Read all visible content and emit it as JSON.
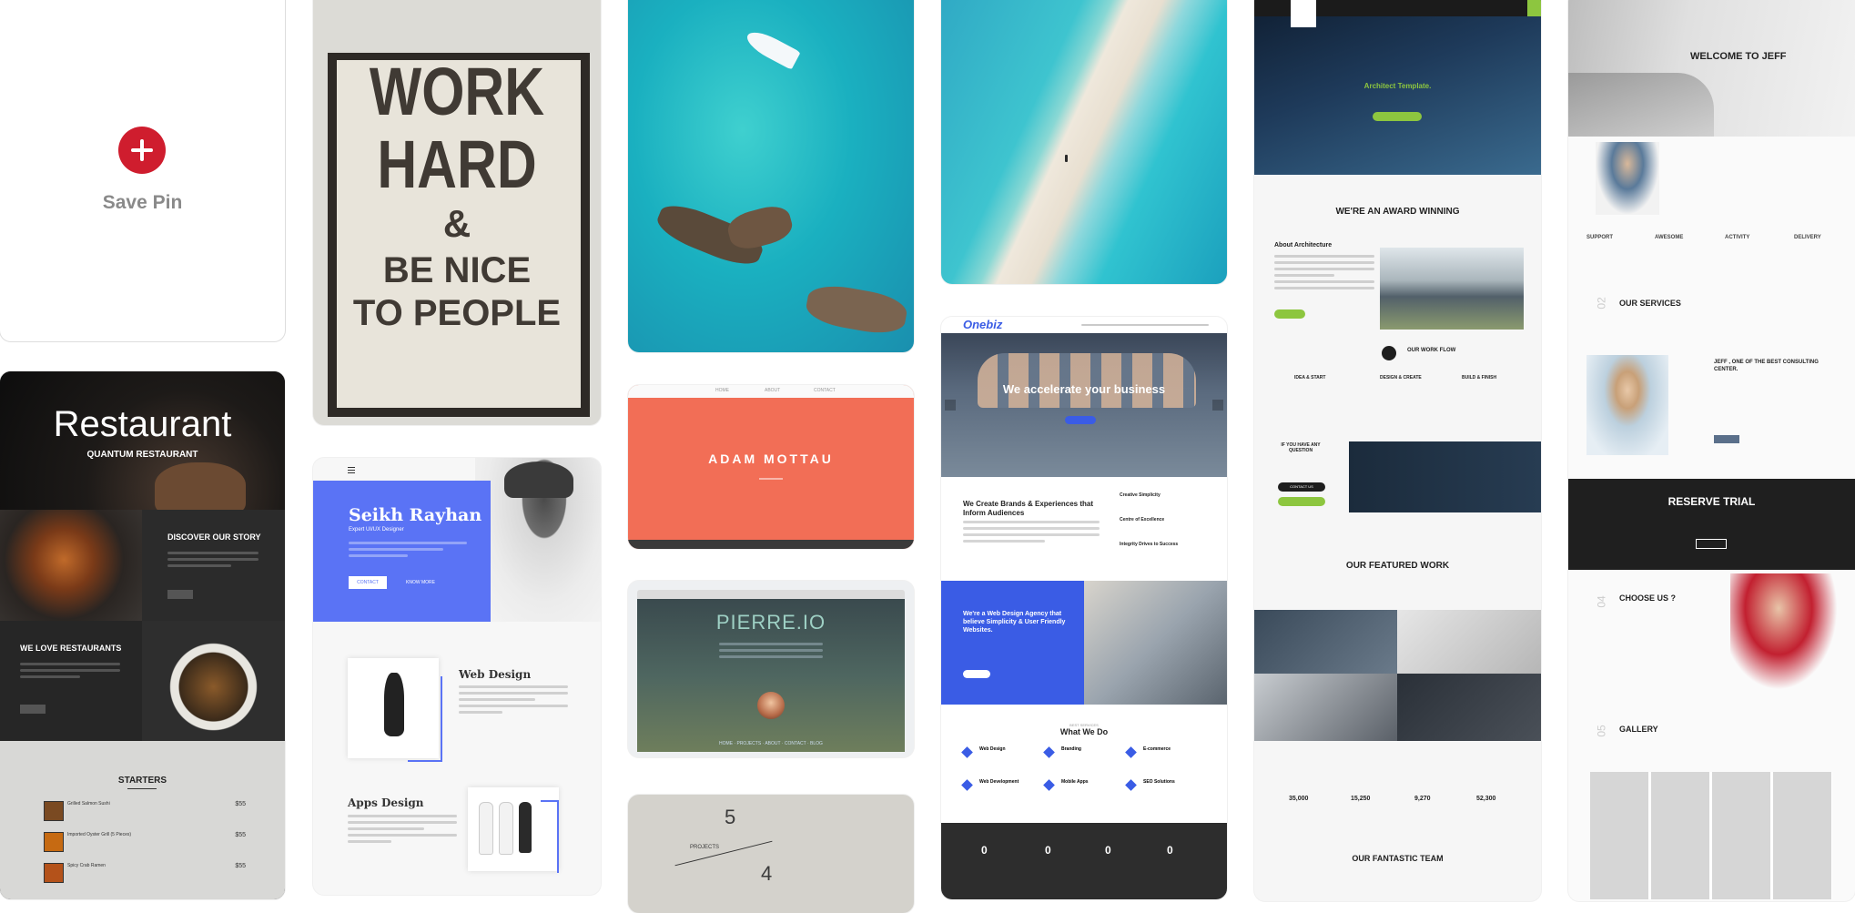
{
  "save_pin": {
    "label": "Save Pin"
  },
  "restaurant": {
    "title": "Restaurant",
    "subtitle": "QUANTUM RESTAURANT",
    "story_heading": "DISCOVER OUR STORY",
    "love_heading": "WE LOVE RESTAURANTS",
    "menu_heading": "STARTERS",
    "menu_items": [
      {
        "name": "Grilled Salmon Sushi",
        "price": "$55"
      },
      {
        "name": "Imported Oyster Grill (5 Pieces)",
        "price": "$55"
      },
      {
        "name": "Spicy Crab Ramen",
        "price": "$55"
      }
    ]
  },
  "poster": {
    "lines": [
      "WORK",
      "HARD",
      "&",
      "BE NICE",
      "TO PEOPLE"
    ]
  },
  "portfolio": {
    "name": "Seikh Rayhan",
    "role": "Expert UI/UX Designer",
    "contact_button": "CONTACT",
    "more_button": "KNOW MORE",
    "section1": "Web Design",
    "section2": "Apps Design"
  },
  "adam": {
    "name": "ADAM MOTTAU",
    "nav": [
      "HOME",
      "ABOUT",
      "CONTACT"
    ]
  },
  "pierre": {
    "title": "PIERRE.IO"
  },
  "projects": {
    "number1": "5",
    "number2": "4",
    "label": "PROJECTS"
  },
  "onebiz": {
    "logo": "Onebiz",
    "hero": "We accelerate your business",
    "brands_heading": "We Create Brands & Experiences that Inform Audiences",
    "features": [
      "Creative Simplicity",
      "Centre of Excellence",
      "Integrity Drives to Success"
    ],
    "agency_heading": "We're a Web Design Agency that believe Simplicity & User Friendly Websites.",
    "what_sub": "BEST SERVICES",
    "what_heading": "What We Do",
    "services": [
      "Web Design",
      "Branding",
      "E-commerce",
      "Web Development",
      "Mobile Apps",
      "SEO Solutions"
    ],
    "stats": [
      "0",
      "0",
      "0",
      "0"
    ]
  },
  "architect": {
    "hero_title": "Architect Template.",
    "award": "WE'RE AN AWARD WINNING",
    "about": "About Architecture",
    "workflow": "OUR WORK FLOW",
    "steps": [
      "IDEA & START",
      "DESIGN & CREATE",
      "BUILD & FINISH"
    ],
    "question": "IF YOU HAVE ANY QUESTION",
    "contact": "CONTACT US",
    "featured": "OUR FEATURED WORK",
    "stats": [
      "35,000",
      "15,250",
      "9,270",
      "52,300"
    ],
    "team": "OUR FANTASTIC TEAM"
  },
  "jeff": {
    "welcome": "WELCOME TO JEFF",
    "features": [
      "SUPPORT",
      "AWESOME",
      "ACTIVITY",
      "DELIVERY"
    ],
    "services_num": "02",
    "services": "OUR SERVICES",
    "consulting": "JEFF , ONE OF THE BEST CONSULTING CENTER.",
    "trial": "RESERVE TRIAL",
    "choose_num": "04",
    "choose": "CHOOSE US ?",
    "gallery_num": "05",
    "gallery": "GALLERY"
  },
  "colors": {
    "pinterest_red": "#e60023",
    "portfolio_blue": "#5a73f5",
    "onebiz_blue": "#3a5ce5",
    "architect_green": "#8dc63f",
    "adam_coral": "#f26e56"
  }
}
